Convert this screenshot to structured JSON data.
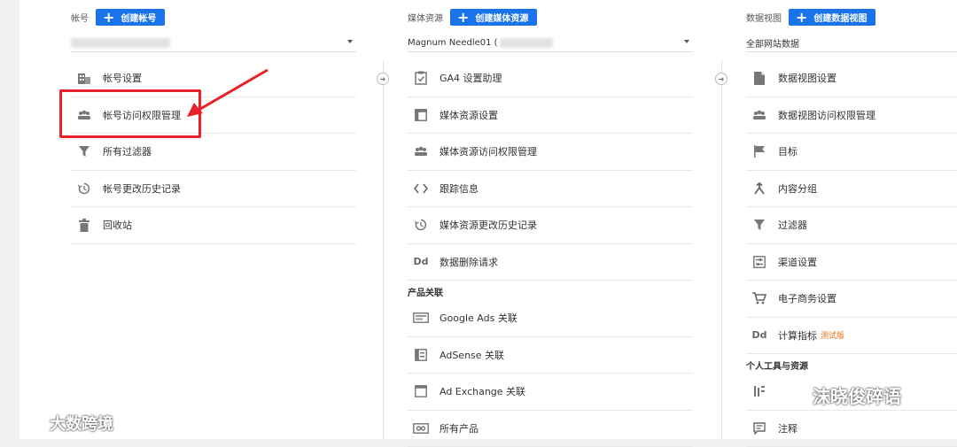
{
  "account": {
    "label": "帐号",
    "create_button": "创建帐号",
    "items": [
      "帐号设置",
      "帐号访问权限管理",
      "所有过滤器",
      "帐号更改历史记录",
      "回收站"
    ]
  },
  "property": {
    "label": "媒体资源",
    "create_button": "创建媒体资源",
    "selector": "Magnum Needle01 (",
    "items": [
      "GA4 设置助理",
      "媒体资源设置",
      "媒体资源访问权限管理",
      "跟踪信息",
      "媒体资源更改历史记录",
      "数据删除请求"
    ],
    "section": "产品关联",
    "section_items": [
      "Google Ads 关联",
      "AdSense 关联",
      "Ad Exchange 关联",
      "所有产品"
    ]
  },
  "view": {
    "label": "数据视图",
    "create_button": "创建数据视图",
    "selector": "全部网站数据",
    "items": [
      "数据视图设置",
      "数据视图访问权限管理",
      "目标",
      "内容分组",
      "过滤器",
      "渠道设置",
      "电子商务设置",
      "计算指标"
    ],
    "beta": "测试版",
    "section": "个人工具与资源",
    "section_items": [
      "注释"
    ]
  },
  "icons": {
    "plus": "+",
    "dd": "Dd"
  },
  "watermarks": {
    "left": "大数跨境",
    "right": "沫晓俊碎语"
  },
  "colors": {
    "primary": "#1a73e8",
    "highlight": "#e8202a",
    "beta": "#e8711a"
  }
}
